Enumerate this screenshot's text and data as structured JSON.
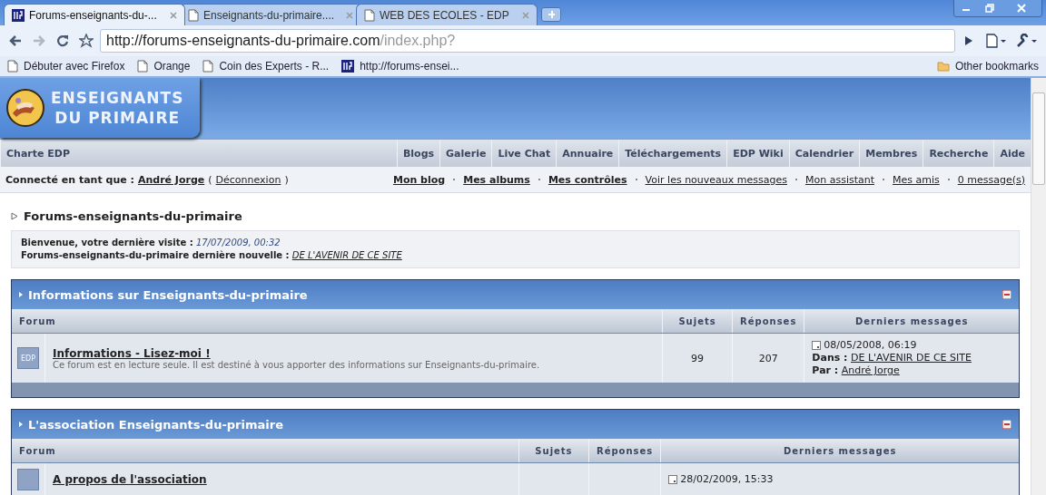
{
  "browser": {
    "tabs": [
      {
        "title": "Forums-enseignants-du-...",
        "selected": true,
        "kind": "site"
      },
      {
        "title": "Enseignants-du-primaire....",
        "selected": false,
        "kind": "page"
      },
      {
        "title": "WEB DES ECOLES - EDP",
        "selected": false,
        "kind": "page"
      }
    ],
    "address": {
      "host": "http://forums-enseignants-du-primaire.com",
      "path": "/index.php?"
    },
    "bookmarks": [
      {
        "label": "Débuter avec Firefox",
        "kind": "page"
      },
      {
        "label": "Orange",
        "kind": "page"
      },
      {
        "label": "Coin des Experts - R...",
        "kind": "page"
      },
      {
        "label": "http://forums-ensei...",
        "kind": "site"
      }
    ],
    "other_bookmarks": "Other bookmarks"
  },
  "site": {
    "logo": {
      "line_1": "ENSEIGNANTS",
      "line_2": "DU PRIMAIRE"
    },
    "nav_left": "Charte EDP",
    "nav_right": [
      "Blogs",
      "Galerie",
      "Live Chat",
      "Annuaire",
      "Téléchargements",
      "EDP Wiki",
      "Calendrier",
      "Membres",
      "Recherche",
      "Aide"
    ],
    "user_bar": {
      "prefix": "Connecté en tant que :",
      "user": "André Jorge",
      "open": "(",
      "logout": "Déconnexion",
      "close": ")",
      "links": [
        {
          "label": "Mon blog",
          "bold": true
        },
        {
          "label": "Mes albums",
          "bold": true
        },
        {
          "label": "Mes contrôles",
          "bold": true
        },
        {
          "label": "Voir les nouveaux messages",
          "bold": false
        },
        {
          "label": "Mon assistant",
          "bold": false
        },
        {
          "label": "Mes amis",
          "bold": false
        },
        {
          "label": "0 message(s)",
          "bold": false
        }
      ]
    },
    "breadcrumb": "Forums-enseignants-du-primaire",
    "welcome": {
      "visit_label": "Bienvenue, votre dernière visite :",
      "visit_date": "17/07/2009, 00:32",
      "news_label": "Forums-enseignants-du-primaire dernière nouvelle :",
      "news_link": "DE L'AVENIR DE CE SITE"
    },
    "categories": [
      {
        "title": "Informations sur Enseignants-du-primaire",
        "columns": [
          "Forum",
          "Sujets",
          "Réponses",
          "Derniers messages"
        ],
        "forums": [
          {
            "icon_text": "EDP",
            "name": "Informations - Lisez-moi !",
            "description": "Ce forum est en lecture seule. Il est destiné à vous apporter des informations sur Enseignants-du-primaire.",
            "topics": "99",
            "replies": "207",
            "last_post": {
              "date": "08/05/2008, 06:19",
              "in_label": "Dans :",
              "in_link": "DE L'AVENIR DE CE SITE",
              "by_label": "Par :",
              "by_link": "André Jorge"
            }
          }
        ]
      },
      {
        "title": "L'association Enseignants-du-primaire",
        "columns": [
          "Forum",
          "Sujets",
          "Réponses",
          "Derniers messages"
        ],
        "forums": [
          {
            "name": "A propos de l'association",
            "last_post": {
              "date": "28/02/2009, 15:33"
            }
          }
        ]
      }
    ]
  }
}
